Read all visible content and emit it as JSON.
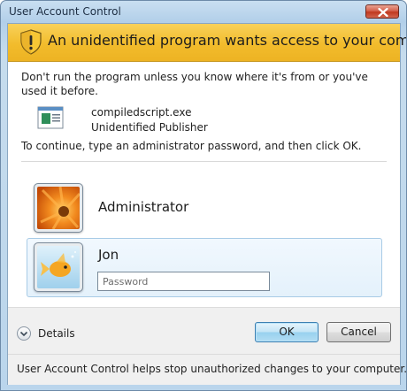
{
  "window": {
    "title": "User Account Control"
  },
  "banner": {
    "text": "An unidentified program wants access to your computer",
    "icon": "shield-warning-icon",
    "color": "#f2bc2c"
  },
  "message": "Don't run the program unless you know where it's from or you've used it before.",
  "program": {
    "name": "compiledscript.exe",
    "publisher": "Unidentified Publisher",
    "icon": "program-icon"
  },
  "instruction": "To continue, type an administrator password, and then click OK.",
  "accounts": [
    {
      "name": "Administrator",
      "picture": "orange-flower-avatar"
    },
    {
      "name": "Jon",
      "picture": "goldfish-avatar",
      "selected": true,
      "password_placeholder": "Password"
    }
  ],
  "footer": {
    "details_label": "Details",
    "ok_label": "OK",
    "cancel_label": "Cancel",
    "note": "User Account Control helps stop unauthorized changes to your computer."
  }
}
